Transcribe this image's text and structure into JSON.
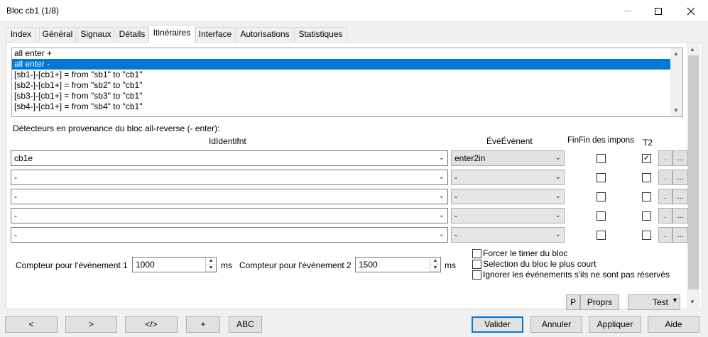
{
  "window": {
    "title": "Bloc cb1 (1/8)"
  },
  "tabs": [
    "Index",
    "Général",
    "Signaux",
    "Détails",
    "Itinéraires",
    "Interface",
    "Autorisations",
    "Statistiques"
  ],
  "itineraries": [
    "all enter +",
    "all enter -",
    "[sb1-]-[cb1+] = from \"sb1\" to \"cb1\"",
    "[sb2-]-[cb1+] = from \"sb2\" to \"cb1\"",
    "[sb3-]-[cb1+] = from \"sb3\" to \"cb1\"",
    "[sb4-]-[cb1+] = from \"sb4\" to \"cb1\""
  ],
  "selected_itinerary": "all enter -",
  "detectors": {
    "heading": "Détecteurs en provenance du bloc all-reverse (- enter):",
    "col_ident": "IdIdentifnt",
    "col_event": "ÉvéÉvénent",
    "col_fin": "FinFin des impons",
    "col_t2": "T2",
    "rows": [
      {
        "ident": "cb1e",
        "event": "enter2in",
        "fin": false,
        "t2": true,
        "btn1": ".",
        "btn2": "..."
      },
      {
        "ident": "-",
        "event": "-",
        "fin": false,
        "t2": false,
        "btn1": ".",
        "btn2": "..."
      },
      {
        "ident": "-",
        "event": "-",
        "fin": false,
        "t2": false,
        "btn1": ".",
        "btn2": "..."
      },
      {
        "ident": "-",
        "event": "-",
        "fin": false,
        "t2": false,
        "btn1": ".",
        "btn2": "..."
      },
      {
        "ident": "-",
        "event": "-",
        "fin": false,
        "t2": false,
        "btn1": ".",
        "btn2": "..."
      }
    ]
  },
  "counters": {
    "c1_label": "Compteur pour l'événement 1",
    "c1_value": "1000",
    "c2_label": "Compteur pour l'événement 2",
    "c2_value": "1500",
    "unit": "ms"
  },
  "options": [
    {
      "label": "Forcer le timer du bloc",
      "checked": false
    },
    {
      "label": "Selection du bloc le plus court",
      "checked": false
    },
    {
      "label": "Ignorer les événements s'ils ne sont pas réservés",
      "checked": false
    }
  ],
  "bottom_buttons": {
    "p": "P",
    "props": "Proprs",
    "test": "Test"
  },
  "footer": {
    "prev": "<",
    "next": ">",
    "code": "</>",
    "plus": "+",
    "abc": "ABC",
    "valider": "Valider",
    "annuler": "Annuler",
    "appliquer": "Appliquer",
    "aide": "Aide"
  }
}
